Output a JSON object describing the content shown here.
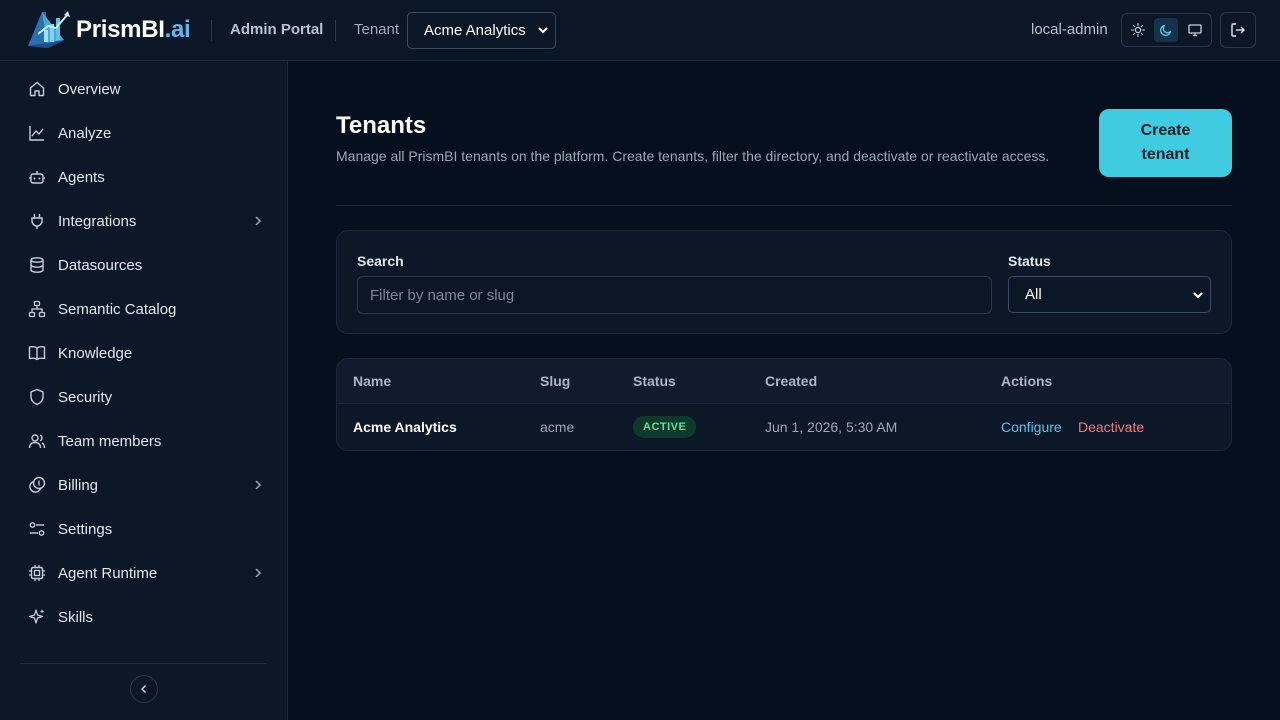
{
  "header": {
    "brand_main": "PrismBI",
    "brand_suffix": ".ai",
    "portal_label": "Admin Portal",
    "tenant_label": "Tenant",
    "tenant_selected": "Acme Analytics",
    "user_name": "local-admin",
    "theme_options": [
      "light",
      "dark",
      "system"
    ],
    "theme_active": "dark"
  },
  "sidebar": {
    "items": [
      {
        "label": "Overview",
        "icon": "home-icon",
        "has_children": false
      },
      {
        "label": "Analyze",
        "icon": "line-chart-icon",
        "has_children": false
      },
      {
        "label": "Agents",
        "icon": "bot-icon",
        "has_children": false
      },
      {
        "label": "Integrations",
        "icon": "plug-icon",
        "has_children": true
      },
      {
        "label": "Datasources",
        "icon": "database-icon",
        "has_children": false
      },
      {
        "label": "Semantic Catalog",
        "icon": "hierarchy-icon",
        "has_children": false
      },
      {
        "label": "Knowledge",
        "icon": "book-icon",
        "has_children": false
      },
      {
        "label": "Security",
        "icon": "shield-icon",
        "has_children": false
      },
      {
        "label": "Team members",
        "icon": "users-icon",
        "has_children": false
      },
      {
        "label": "Billing",
        "icon": "coins-icon",
        "has_children": true
      },
      {
        "label": "Settings",
        "icon": "sliders-icon",
        "has_children": false
      },
      {
        "label": "Agent Runtime",
        "icon": "cpu-icon",
        "has_children": true
      },
      {
        "label": "Skills",
        "icon": "sparkles-icon",
        "has_children": false
      }
    ]
  },
  "main": {
    "title": "Tenants",
    "description": "Manage all PrismBI tenants on the platform. Create tenants, filter the directory, and deactivate or reactivate access.",
    "create_button": "Create tenant",
    "filters": {
      "search_label": "Search",
      "search_placeholder": "Filter by name or slug",
      "search_value": "",
      "status_label": "Status",
      "status_selected": "All"
    },
    "table": {
      "columns": [
        "Name",
        "Slug",
        "Status",
        "Created",
        "Actions"
      ],
      "rows": [
        {
          "name": "Acme Analytics",
          "slug": "acme",
          "status": "ACTIVE",
          "created": "Jun 1, 2026, 5:30 AM",
          "actions": [
            "Configure",
            "Deactivate"
          ]
        }
      ]
    }
  },
  "colors": {
    "accent": "#3fcbe0",
    "active_badge": "#5fe0a0",
    "danger": "#f07c7c",
    "link": "#4cc8e8"
  }
}
